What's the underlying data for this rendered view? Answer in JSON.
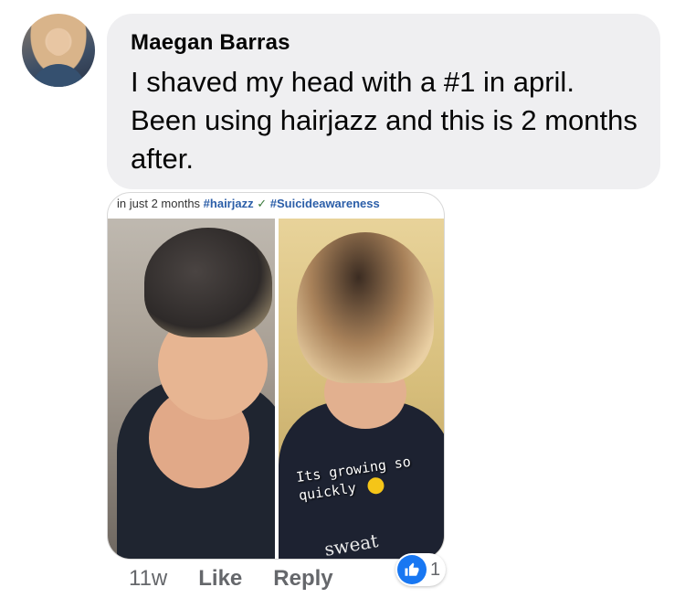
{
  "comment": {
    "author": "Maegan Barras",
    "text": "I shaved my head with a #1 in april. Been using hairjazz and this is 2 months after.",
    "timestamp": "11w",
    "like_label": "Like",
    "reply_label": "Reply",
    "reaction_count": "1",
    "reaction_icon": "thumbs-up-icon"
  },
  "photo": {
    "caption_prefix": "in just 2 months",
    "tag1": "#hairjazz",
    "check": "✓",
    "tag2": "#Suicideawareness",
    "overlay_text": "Its growing so quickly",
    "shirt_text": "sweat"
  },
  "colors": {
    "bubble": "#efeff1",
    "secondary_text": "#65676b",
    "like_blue": "#1877f2"
  }
}
